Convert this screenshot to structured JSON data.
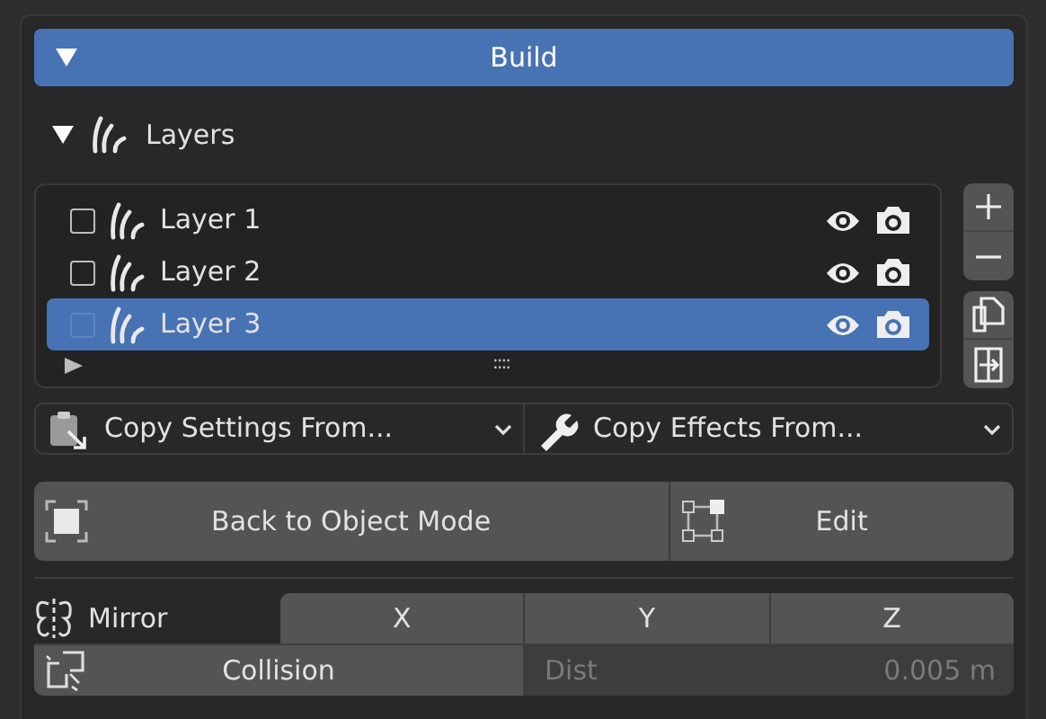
{
  "panel": {
    "title": "Build",
    "expanded": true
  },
  "subpanel": {
    "title": "Layers",
    "expanded": true
  },
  "layers": [
    {
      "name": "Layer 1",
      "checked": false,
      "selected": false
    },
    {
      "name": "Layer 2",
      "checked": false,
      "selected": false
    },
    {
      "name": "Layer 3",
      "checked": false,
      "selected": true
    }
  ],
  "list_grip": "::::",
  "dropdowns": [
    "Copy Settings From...",
    "Copy Effects From..."
  ],
  "actions": [
    "Back to Object Mode",
    "Edit"
  ],
  "mirror": {
    "label": "Mirror",
    "axes": [
      {
        "label": "X",
        "on": false
      },
      {
        "label": "Y",
        "on": false
      },
      {
        "label": "Z",
        "on": false
      }
    ]
  },
  "collision": {
    "label": "Collision",
    "on": false
  },
  "dist": {
    "label": "Dist",
    "value": "0.005 m",
    "disabled": true
  }
}
